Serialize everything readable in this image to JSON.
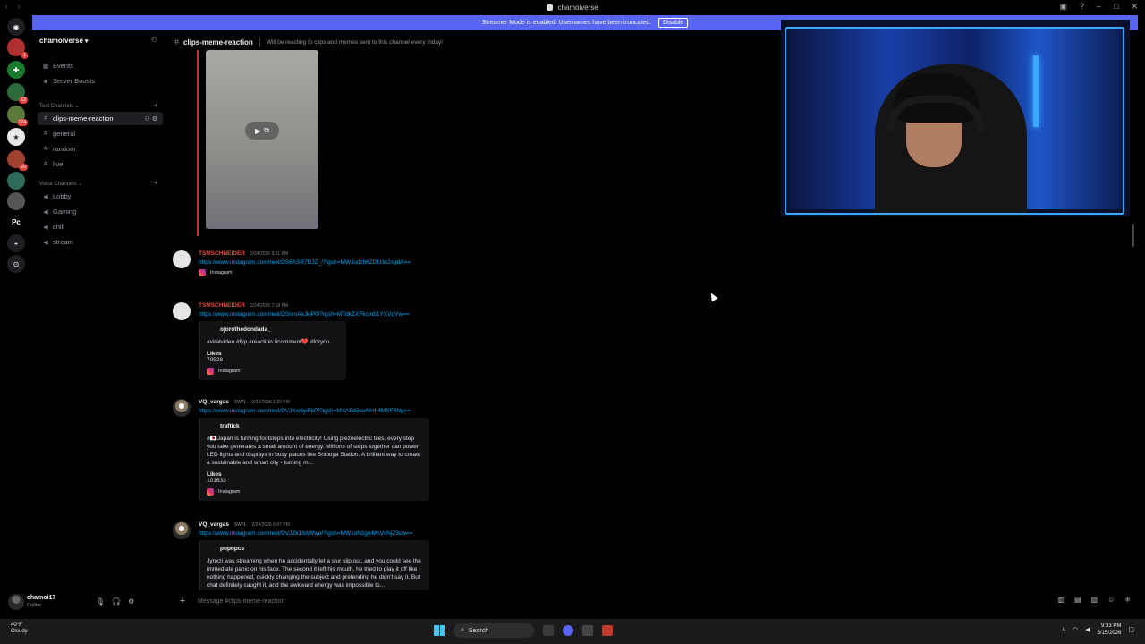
{
  "window": {
    "title": "chamoiverse",
    "nav": "‹ ›"
  },
  "banner": {
    "text": "Streamer Mode is enabled. Usernames have been truncated.",
    "action": "Disable"
  },
  "servers": [
    {
      "name": "home",
      "badge": ""
    },
    {
      "name": "server-1",
      "badge": "1"
    },
    {
      "name": "server-2",
      "badge": ""
    },
    {
      "name": "server-3",
      "badge": "12"
    },
    {
      "name": "server-4",
      "badge": "124"
    },
    {
      "name": "server-5",
      "badge": ""
    },
    {
      "name": "server-6",
      "badge": "26"
    },
    {
      "name": "server-7",
      "badge": ""
    },
    {
      "name": "server-8",
      "badge": ""
    },
    {
      "name": "Pc",
      "badge": ""
    }
  ],
  "sidebar": {
    "guild": "chamoiverse",
    "top_items": [
      {
        "label": "Events",
        "icon": "calendar-icon"
      },
      {
        "label": "Server Boosts",
        "icon": "boost-icon"
      }
    ],
    "text_category": "Text Channels",
    "text_channels": [
      {
        "label": "clips-meme-reaction",
        "active": true
      },
      {
        "label": "general"
      },
      {
        "label": "random"
      },
      {
        "label": "live"
      }
    ],
    "voice_category": "Voice Channels",
    "voice_channels": [
      {
        "label": "Lobby"
      },
      {
        "label": "Gaming"
      },
      {
        "label": "chill"
      },
      {
        "label": "stream"
      }
    ]
  },
  "header": {
    "channel": "clips-meme-reaction",
    "topic": "Will be reacting to clips and memes sent to this channel every friday!"
  },
  "messages": [
    {
      "user": "TSMSCHNEIDER",
      "time": "2/24/2026 6:51 PM",
      "link": "https://www.instagram.com/reel/DS6ASR7DJZ_/?igsh=MWJudzh6ZDU3c2xqdA==",
      "provider": "Instagram"
    },
    {
      "user": "TSMSCHNEIDER",
      "time": "2/24/2026 7:19 PM",
      "link": "https://www.instagram.com/reel/DSnmAxJkiP0/?igsh=MTdkZXFkcm51YXVqYw==",
      "embed_author": "ojorothedondada_",
      "embed_desc": "#viralvideo #fyp #reaction #comment❤️ #foryou..",
      "likes_label": "Likes",
      "likes": "70528",
      "provider": "Instagram"
    },
    {
      "user": "VQ_vargas",
      "tag": "SWFL",
      "time": "2/24/2026 1:29 PM",
      "link": "https://www.instagram.com/reel/DVJXw8yiFkP/?igsh=MXA5d3cwNHh4MXF4Ng==",
      "embed_author": "traftick",
      "embed_desc": "#🇯🇵Japan is turning footsteps into electricity! Using piezoelectric tiles, every step you take generates a small amount of energy. Millions of steps together can power LED lights and displays in busy places like Shibuya Station. A brilliant way to create a sustainable and smart city • turning m...",
      "likes_label": "Likes",
      "likes": "101633",
      "provider": "Instagram"
    },
    {
      "user": "VQ_vargas",
      "tag": "SWFL",
      "time": "2/24/2026 6:07 PM",
      "link": "https://www.instagram.com/reel/DVJZk18AWwo/?igsh=MW1oNzgwMnVsNjZ3cw==",
      "embed_author": "popnpcs",
      "embed_desc": "Jynxzi was streaming when he accidentally let a slur slip out, and you could see the immediate panic on his face. The second it left his mouth, he tried to play it off like nothing happened, quickly changing the subject and pretending he didn't say it. But chat definitely caught it, and the awkward energy was impossible to..."
    }
  ],
  "composer": {
    "placeholder": "Message #clips-meme-reaction"
  },
  "user": {
    "name": "chamoi17",
    "status": "Online"
  },
  "taskbar": {
    "temp": "40°F",
    "weather": "Cloudy",
    "search": "Search",
    "time": "9:33 PM",
    "date": "3/15/2026"
  },
  "colors": {
    "accent": "#5865f2",
    "username_red": "#e74c3c",
    "link": "#00a8fc"
  }
}
